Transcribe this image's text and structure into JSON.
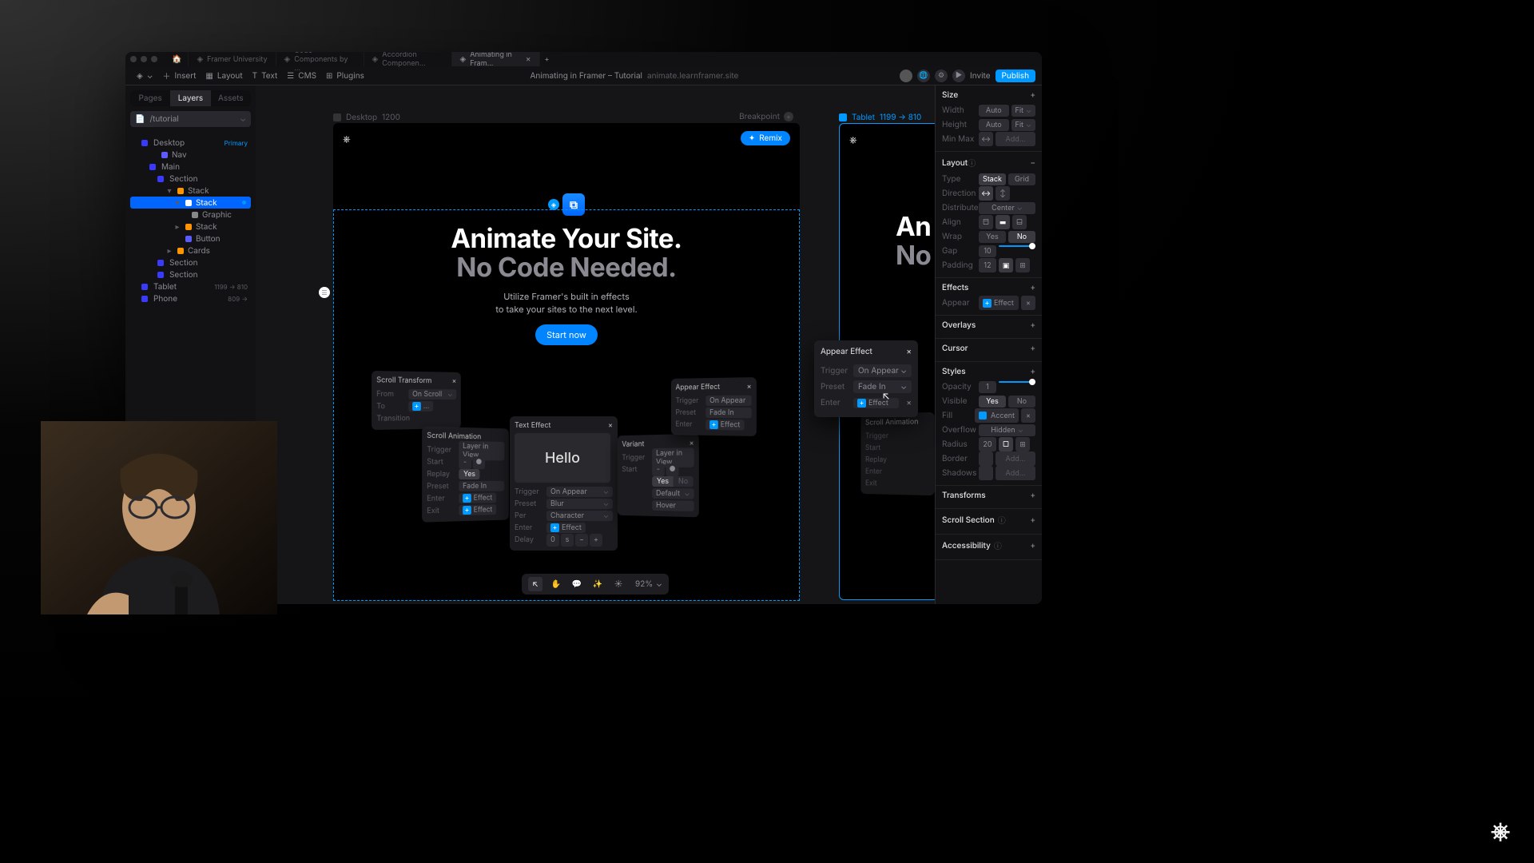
{
  "tabs": {
    "home_icon": "🏠",
    "items": [
      {
        "icon": "◈",
        "label": "Framer University"
      },
      {
        "icon": "◈",
        "label": "Code Components by ..."
      },
      {
        "icon": "◈",
        "label": "Accordion Componen..."
      },
      {
        "icon": "◈",
        "label": "Animating in Fram..."
      }
    ],
    "active_index": 3
  },
  "toolbar": {
    "app_icon": "◈",
    "insert": "Insert",
    "layout": "Layout",
    "text": "Text",
    "cms": "CMS",
    "plugins": "Plugins",
    "title": "Animating in Framer – Tutorial",
    "url": "animate.learnframer.site",
    "invite": "Invite",
    "publish": "Publish"
  },
  "sidebar": {
    "tabs": [
      "Pages",
      "Layers",
      "Assets"
    ],
    "active_tab": 1,
    "file": "/tutorial",
    "tree": [
      {
        "indent": 1,
        "icon": "frame",
        "label": "Desktop",
        "arrow": "▾",
        "badge": "Primary",
        "badgeClass": "primary"
      },
      {
        "indent": 2,
        "icon": "comp",
        "label": "Nav",
        "arrow": ""
      },
      {
        "indent": 2,
        "icon": "frame",
        "label": "Main",
        "arrow": "▾"
      },
      {
        "indent": 3,
        "icon": "frame",
        "label": "Section",
        "arrow": "▾"
      },
      {
        "indent": 4,
        "icon": "stack",
        "label": "Stack",
        "arrow": "▾"
      },
      {
        "indent": 5,
        "icon": "stack",
        "label": "Stack",
        "arrow": "▾",
        "selected": true,
        "hasEffect": true
      },
      {
        "indent": 6,
        "icon": "text",
        "label": "Graphic",
        "arrow": ""
      },
      {
        "indent": 5,
        "icon": "stack",
        "label": "Stack",
        "arrow": "▸"
      },
      {
        "indent": 5,
        "icon": "comp",
        "label": "Button",
        "arrow": ""
      },
      {
        "indent": 4,
        "icon": "stack",
        "label": "Cards",
        "arrow": "▸"
      },
      {
        "indent": 3,
        "icon": "frame",
        "label": "Section",
        "arrow": "▸"
      },
      {
        "indent": 3,
        "icon": "frame",
        "label": "Section",
        "arrow": "▸"
      },
      {
        "indent": 1,
        "icon": "frame",
        "label": "Tablet",
        "arrow": "▸",
        "badge": "1199 → 810",
        "badgeClass": "dim"
      },
      {
        "indent": 1,
        "icon": "frame",
        "label": "Phone",
        "arrow": "▸",
        "badge": "809 → ",
        "badgeClass": "dim"
      }
    ]
  },
  "canvas": {
    "desktop": {
      "name": "Desktop",
      "width": "1200",
      "breakpoint_label": "Breakpoint"
    },
    "tablet": {
      "name": "Tablet",
      "range": "1199 → 810"
    },
    "hero": {
      "remix": "Remix",
      "title1": "Animate Your Site.",
      "title2": "No Code Needed.",
      "sub1": "Utilize Framer's built in effects",
      "sub2": "to take your sites to the next level.",
      "cta": "Start now",
      "tablet_t1": "An",
      "tablet_t2": "No"
    },
    "text_effect": {
      "title": "Text Effect",
      "hello": "Hello",
      "trigger_l": "Trigger",
      "trigger_v": "On Appear",
      "preset_l": "Preset",
      "preset_v": "Blur",
      "per_l": "Per",
      "per_v": "Character",
      "enter_l": "Enter",
      "enter_v": "Effect",
      "delay_l": "Delay",
      "delay_v": "0",
      "delay_unit": "s"
    },
    "scroll_a": {
      "title": "Scroll Transform",
      "from_l": "From",
      "from_v": "On Scroll",
      "to_l": "To",
      "trans_l": "Transition"
    },
    "scroll_b": {
      "title": "Scroll Animation",
      "trigger_l": "Trigger",
      "trigger_v": "Layer in View",
      "start_l": "Start",
      "replay_l": "Replay",
      "replay_yes": "Yes",
      "preset_l": "Preset",
      "preset_v": "Fade In",
      "enter_l": "Enter",
      "enter_v": "Effect",
      "exit_l": "Exit",
      "exit_v": "Effect"
    },
    "appear_r": {
      "title": "Appear Effect",
      "trigger_l": "Trigger",
      "trigger_v": "On Appear",
      "preset_l": "Preset",
      "preset_v": "Fade In",
      "enter_l": "Enter",
      "enter_v": "Effect"
    },
    "variant": {
      "title": "Variant",
      "trigger_l": "Trigger",
      "trigger_v": "Layer in View",
      "start_l": "Start",
      "yes": "Yes",
      "no": "No",
      "default": "Default",
      "hover": "Hover"
    },
    "scroll_c": {
      "title": "Scroll Animation",
      "trigger_l": "Trigger",
      "start_l": "Start",
      "replay_l": "Replay",
      "enter_l": "Enter",
      "exit_l": "Exit"
    },
    "tools": {
      "cursor": "↖",
      "hand": "✋",
      "comment": "💬",
      "effects": "✨",
      "sun": "☀",
      "zoom": "92%"
    }
  },
  "popup": {
    "title": "Appear Effect",
    "trigger_l": "Trigger",
    "trigger_v": "On Appear",
    "preset_l": "Preset",
    "preset_v": "Fade In",
    "enter_l": "Enter",
    "enter_v": "Effect"
  },
  "inspector": {
    "size": {
      "title": "Size",
      "width_l": "Width",
      "width_v": "Auto",
      "width_fit": "Fit",
      "height_l": "Height",
      "height_v": "Auto",
      "height_fit": "Fit",
      "minmax_l": "Min Max",
      "minmax_v": "Add..."
    },
    "layout": {
      "title": "Layout",
      "type_l": "Type",
      "type_stack": "Stack",
      "type_grid": "Grid",
      "dir_l": "Direction",
      "dist_l": "Distribute",
      "dist_v": "Center",
      "align_l": "Align",
      "wrap_l": "Wrap",
      "wrap_yes": "Yes",
      "wrap_no": "No",
      "gap_l": "Gap",
      "gap_v": "10",
      "pad_l": "Padding",
      "pad_v": "12"
    },
    "effects": {
      "title": "Effects",
      "appear_l": "Appear",
      "appear_v": "Effect"
    },
    "overlays": {
      "title": "Overlays"
    },
    "cursor": {
      "title": "Cursor"
    },
    "styles": {
      "title": "Styles",
      "opacity_l": "Opacity",
      "opacity_v": "1",
      "visible_l": "Visible",
      "visible_yes": "Yes",
      "visible_no": "No",
      "fill_l": "Fill",
      "fill_v": "Accent",
      "overflow_l": "Overflow",
      "overflow_v": "Hidden",
      "radius_l": "Radius",
      "radius_v": "20",
      "border_l": "Border",
      "border_v": "Add...",
      "shadows_l": "Shadows",
      "shadows_v": "Add..."
    },
    "transforms": {
      "title": "Transforms"
    },
    "scroll_section": {
      "title": "Scroll Section"
    },
    "accessibility": {
      "title": "Accessibility"
    }
  }
}
